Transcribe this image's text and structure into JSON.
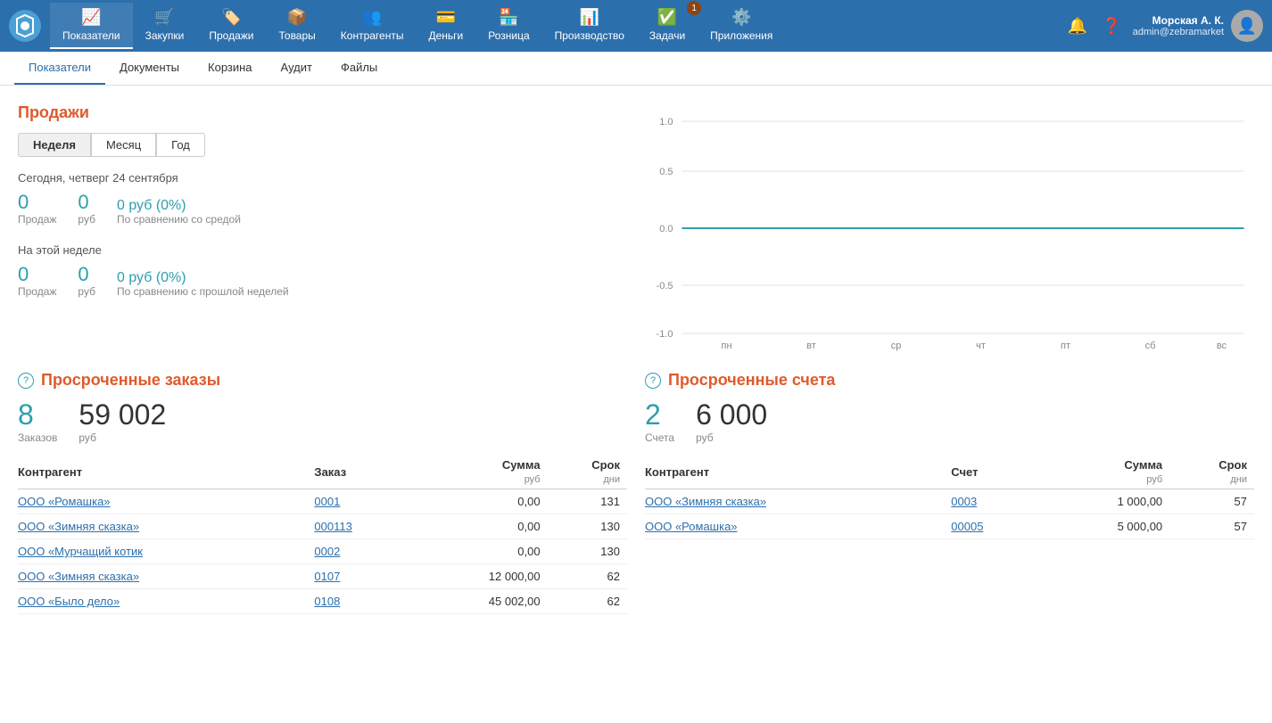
{
  "topNav": {
    "items": [
      {
        "label": "Показатели",
        "icon": "📈",
        "active": true
      },
      {
        "label": "Закупки",
        "icon": "🛒",
        "active": false
      },
      {
        "label": "Продажи",
        "icon": "🏷️",
        "active": false
      },
      {
        "label": "Товары",
        "icon": "📦",
        "active": false
      },
      {
        "label": "Контрагенты",
        "icon": "👥",
        "active": false
      },
      {
        "label": "Деньги",
        "icon": "💳",
        "active": false
      },
      {
        "label": "Розница",
        "icon": "🏪",
        "active": false
      },
      {
        "label": "Производство",
        "icon": "📊",
        "active": false
      },
      {
        "label": "Задачи",
        "icon": "✅",
        "active": false,
        "badge": "1"
      },
      {
        "label": "Приложения",
        "icon": "⚙️",
        "active": false
      }
    ],
    "user": {
      "name": "Морская А. К.",
      "email": "admin@zebramarket"
    }
  },
  "subNav": {
    "items": [
      {
        "label": "Показатели",
        "active": true
      },
      {
        "label": "Документы",
        "active": false
      },
      {
        "label": "Корзина",
        "active": false
      },
      {
        "label": "Аудит",
        "active": false
      },
      {
        "label": "Файлы",
        "active": false
      }
    ]
  },
  "sales": {
    "title": "Продажи",
    "periodButtons": [
      "Неделя",
      "Месяц",
      "Год"
    ],
    "activeButton": "Неделя",
    "today": {
      "label": "Сегодня, четверг 24 сентября",
      "count": "0",
      "countLabel": "Продаж",
      "sum": "0",
      "sumLabel": "руб",
      "compare": "0 руб (0%)",
      "compareLabel": "По сравнению со средой"
    },
    "week": {
      "label": "На этой неделе",
      "count": "0",
      "countLabel": "Продаж",
      "sum": "0",
      "sumLabel": "руб",
      "compare": "0 руб (0%)",
      "compareLabel": "По сравнению с прошлой неделей"
    }
  },
  "chart": {
    "yLabels": [
      "1.0",
      "0.5",
      "0.0",
      "-0.5",
      "-1.0"
    ],
    "xLabels": [
      "пн",
      "вт",
      "ср",
      "чт",
      "пт",
      "сб",
      "вс"
    ]
  },
  "overdueOrders": {
    "title": "Просроченные заказы",
    "count": "8",
    "countLabel": "Заказов",
    "sum": "59 002",
    "sumLabel": "руб",
    "columns": [
      {
        "label": "Контрагент",
        "sub": ""
      },
      {
        "label": "Заказ",
        "sub": ""
      },
      {
        "label": "Сумма",
        "sub": "руб"
      },
      {
        "label": "Срок",
        "sub": "дни"
      }
    ],
    "rows": [
      {
        "counterparty": "ООО «Ромашка»",
        "order": "0001",
        "sum": "0,00",
        "days": "131"
      },
      {
        "counterparty": "ООО «Зимняя сказка»",
        "order": "000113",
        "sum": "0,00",
        "days": "130"
      },
      {
        "counterparty": "ООО «Мурчащий котик",
        "order": "0002",
        "sum": "0,00",
        "days": "130"
      },
      {
        "counterparty": "ООО «Зимняя сказка»",
        "order": "0107",
        "sum": "12 000,00",
        "days": "62"
      },
      {
        "counterparty": "ООО «Было дело»",
        "order": "0108",
        "sum": "45 002,00",
        "days": "62"
      }
    ]
  },
  "overdueInvoices": {
    "title": "Просроченные счета",
    "count": "2",
    "countLabel": "Счета",
    "sum": "6 000",
    "sumLabel": "руб",
    "columns": [
      {
        "label": "Контрагент",
        "sub": ""
      },
      {
        "label": "Счет",
        "sub": ""
      },
      {
        "label": "Сумма",
        "sub": "руб"
      },
      {
        "label": "Срок",
        "sub": "дни"
      }
    ],
    "rows": [
      {
        "counterparty": "ООО «Зимняя сказка»",
        "invoice": "0003",
        "sum": "1 000,00",
        "days": "57"
      },
      {
        "counterparty": "ООО «Ромашка»",
        "invoice": "00005",
        "sum": "5 000,00",
        "days": "57"
      }
    ]
  }
}
